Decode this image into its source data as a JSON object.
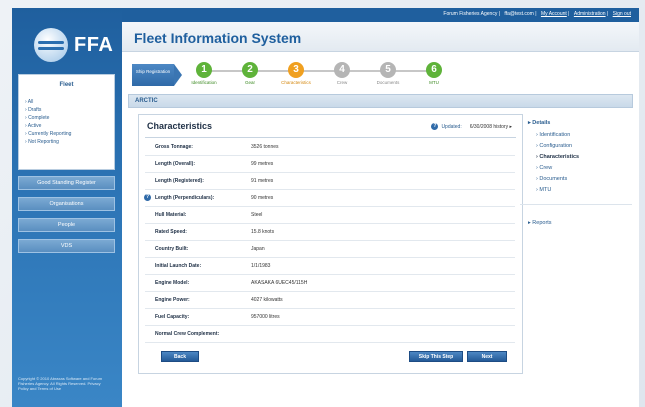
{
  "brand": {
    "logo_text": "FFA"
  },
  "header": {
    "top_links": [
      "Forum Fisheries Agency",
      "ffa@test.com",
      "My Account",
      "Administration",
      "Sign out"
    ],
    "title": "Fleet Information System"
  },
  "sidebar": {
    "fleet_title": "Fleet",
    "items": [
      "All",
      "Drafts",
      "Complete",
      "Active",
      "Currently Reporting",
      "Not Reporting"
    ],
    "buttons": [
      "Good Standing Register",
      "Organisations",
      "People",
      "VDS"
    ],
    "copyright": "Copyright © 2010 Abraxas Software and Forum Fisheries Agency. All Rights Reserved. Privacy Policy and Terms of Use"
  },
  "wizard": {
    "current": "Ship Registration",
    "steps": [
      {
        "num": "1",
        "label": "Identification",
        "color": "#5fb33a"
      },
      {
        "num": "2",
        "label": "Gear",
        "color": "#5fb33a"
      },
      {
        "num": "3",
        "label": "Characteristics",
        "color": "#f0a020"
      },
      {
        "num": "4",
        "label": "Crew",
        "color": "#b5b5b5"
      },
      {
        "num": "5",
        "label": "Documents",
        "color": "#b5b5b5"
      },
      {
        "num": "6",
        "label": "MTU",
        "color": "#5fb33a"
      }
    ]
  },
  "vessel": {
    "name": "ARCTIC"
  },
  "panel": {
    "title": "Characteristics",
    "updated_label": "Updated:",
    "updated_value": "6/30/2008 history ▸",
    "fields": [
      {
        "label": "Gross Tonnage:",
        "value": "3526 tonnes"
      },
      {
        "label": "Length (Overall):",
        "value": "99 metres"
      },
      {
        "label": "Length (Registered):",
        "value": "91 metres"
      },
      {
        "label": "Length (Perpendiculars):",
        "value": "90 metres"
      },
      {
        "label": "Hull Material:",
        "value": "Steel"
      },
      {
        "label": "Rated Speed:",
        "value": "15.8 knots"
      },
      {
        "label": "Country Built:",
        "value": "Japan"
      },
      {
        "label": "Initial Launch Date:",
        "value": "1/1/1983"
      },
      {
        "label": "Engine Model:",
        "value": "AKASAKA 6UEC45/115H"
      },
      {
        "label": "Engine Power:",
        "value": "4027 kilowatts"
      },
      {
        "label": "Fuel Capacity:",
        "value": "957000 litres"
      },
      {
        "label": "Normal Crew Complement:",
        "value": ""
      }
    ],
    "back_label": "Back",
    "skip_label": "Skip This Step",
    "next_label": "Next"
  },
  "details": {
    "header": "Details",
    "items": [
      "Identification",
      "Configuration",
      "Characteristics",
      "Crew",
      "Documents",
      "MTU"
    ],
    "reports": "Reports"
  }
}
